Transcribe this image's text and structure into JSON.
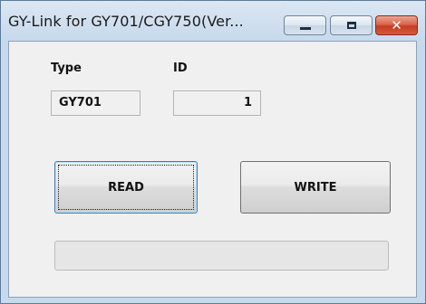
{
  "window": {
    "title": "GY-Link for GY701/CGY750(Ver...",
    "controls": {
      "minimize_icon": "minimize-icon",
      "maximize_icon": "maximize-icon",
      "close_icon": "close-icon",
      "close_glyph": "✕"
    }
  },
  "form": {
    "type_label": "Type",
    "id_label": "ID",
    "type_value": "GY701",
    "id_value": "1"
  },
  "buttons": {
    "read_label": "READ",
    "write_label": "WRITE"
  },
  "progress": {
    "value": 0
  },
  "colors": {
    "titlebar": "#c7d9ec",
    "close_button": "#c63c22",
    "focus_border": "#3c7fb1",
    "progress_fill": "#06b025"
  }
}
